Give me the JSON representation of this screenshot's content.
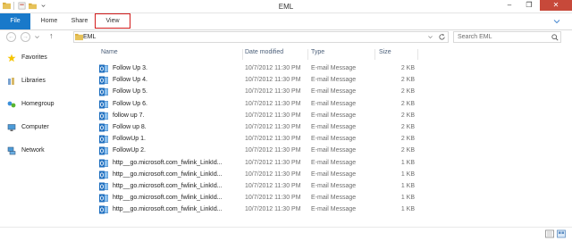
{
  "window": {
    "title": "EML"
  },
  "ribbon": {
    "tabs": {
      "file": "File",
      "home": "Home",
      "share": "Share",
      "view": "View"
    }
  },
  "address": {
    "path": "EML",
    "search_placeholder": "Search EML"
  },
  "nav_pane": {
    "favorites": "Favorites",
    "libraries": "Libraries",
    "homegroup": "Homegroup",
    "computer": "Computer",
    "network": "Network"
  },
  "columns": {
    "name": "Name",
    "date": "Date modified",
    "type": "Type",
    "size": "Size"
  },
  "files": [
    {
      "name": "Follow Up 3.",
      "date": "10/7/2012 11:30 PM",
      "type": "E-mail Message",
      "size": "2 KB"
    },
    {
      "name": "Follow Up 4.",
      "date": "10/7/2012 11:30 PM",
      "type": "E-mail Message",
      "size": "2 KB"
    },
    {
      "name": "Follow Up 5.",
      "date": "10/7/2012 11:30 PM",
      "type": "E-mail Message",
      "size": "2 KB"
    },
    {
      "name": "Follow Up 6.",
      "date": "10/7/2012 11:30 PM",
      "type": "E-mail Message",
      "size": "2 KB"
    },
    {
      "name": "follow up 7.",
      "date": "10/7/2012 11:30 PM",
      "type": "E-mail Message",
      "size": "2 KB"
    },
    {
      "name": "Follow up 8.",
      "date": "10/7/2012 11:30 PM",
      "type": "E-mail Message",
      "size": "2 KB"
    },
    {
      "name": "FollowUp 1.",
      "date": "10/7/2012 11:30 PM",
      "type": "E-mail Message",
      "size": "2 KB"
    },
    {
      "name": "FollowUp 2.",
      "date": "10/7/2012 11:30 PM",
      "type": "E-mail Message",
      "size": "2 KB"
    },
    {
      "name": "http__go.microsoft.com_fwlink_LinkId...",
      "date": "10/7/2012 11:30 PM",
      "type": "E-mail Message",
      "size": "1 KB"
    },
    {
      "name": "http__go.microsoft.com_fwlink_LinkId...",
      "date": "10/7/2012 11:30 PM",
      "type": "E-mail Message",
      "size": "1 KB"
    },
    {
      "name": "http__go.microsoft.com_fwlink_LinkId...",
      "date": "10/7/2012 11:30 PM",
      "type": "E-mail Message",
      "size": "1 KB"
    },
    {
      "name": "http__go.microsoft.com_fwlink_LinkId...",
      "date": "10/7/2012 11:30 PM",
      "type": "E-mail Message",
      "size": "1 KB"
    },
    {
      "name": "http__go.microsoft.com_fwlink_LinkId...",
      "date": "10/7/2012 11:30 PM",
      "type": "E-mail Message",
      "size": "1 KB"
    }
  ],
  "colors": {
    "accent": "#1979ca",
    "highlight_box": "#d21c1c",
    "close": "#c7493a"
  },
  "icons": [
    "folder-icon",
    "outlook-message-icon",
    "star-icon",
    "library-icon",
    "homegroup-icon",
    "computer-icon",
    "network-icon",
    "search-icon",
    "refresh-icon"
  ]
}
